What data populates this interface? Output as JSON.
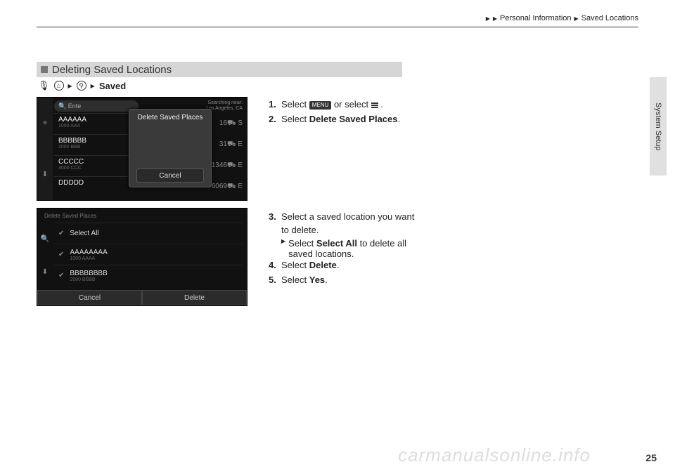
{
  "header": {
    "crumb1": "Personal Information",
    "crumb2": "Saved Locations"
  },
  "sideTab": "System Setup",
  "sectionTitle": "Deleting Saved Locations",
  "breadcrumb": {
    "saved": "Saved"
  },
  "screen1": {
    "searchPlaceholder": "Ente",
    "searchingNear": "Searching near:",
    "searchingLoc": "Los Angeles, CA",
    "rows": [
      {
        "name": "AAAAAA",
        "sub": "1000 AAA",
        "right": "16⛟  S"
      },
      {
        "name": "BBBBBB",
        "sub": "2000 BBB",
        "right": "31⛟  E"
      },
      {
        "name": "CCCCC",
        "sub": "3000 CCC",
        "right": "1346⛟  E"
      },
      {
        "name": "DDDDD",
        "sub": "",
        "right": "6069⛟  E"
      }
    ],
    "popupTitle": "Delete Saved Places",
    "popupCancel": "Cancel"
  },
  "screen2": {
    "title": "Delete Saved Places",
    "rows": [
      {
        "name": "Select All",
        "sub": ""
      },
      {
        "name": "AAAAAAAA",
        "sub": "1000 AAAA"
      },
      {
        "name": "BBBBBBBB",
        "sub": "2000 BBBB"
      }
    ],
    "cancel": "Cancel",
    "delete": "Delete"
  },
  "steps": {
    "s1a": "Select ",
    "s1b": " or select ",
    "s1c": ".",
    "menuLabel": "MENU",
    "s2a": "Select ",
    "s2b": "Delete Saved Places",
    "s2c": ".",
    "s3a": "Select a saved location you want",
    "s3b": "to delete.",
    "s3sub_a": "Select ",
    "s3sub_b": "Select All",
    "s3sub_c": " to delete all",
    "s3sub_d": "saved locations.",
    "s4a": "Select ",
    "s4b": "Delete",
    "s4c": ".",
    "s5a": "Select ",
    "s5b": "Yes",
    "s5c": "."
  },
  "pageNumber": "25",
  "watermark": "carmanualsonline.info"
}
